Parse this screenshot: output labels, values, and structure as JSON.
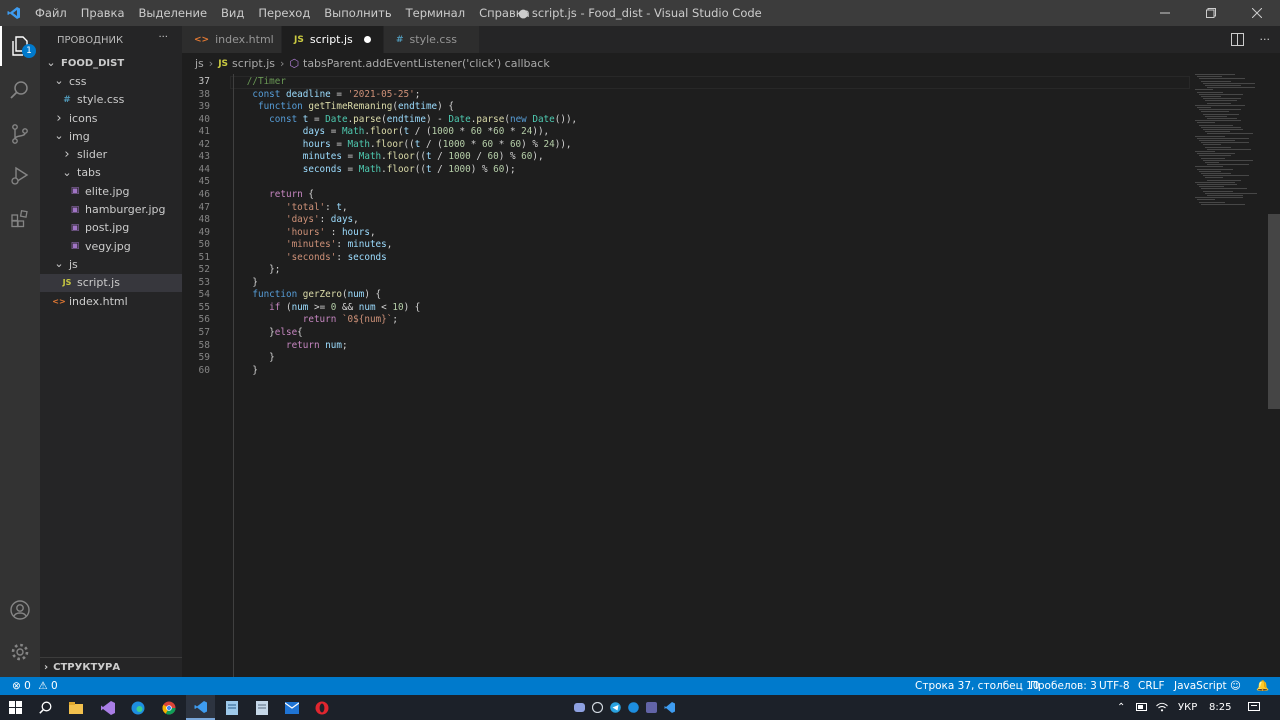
{
  "titlebar": {
    "menu": [
      "Файл",
      "Правка",
      "Выделение",
      "Вид",
      "Переход",
      "Выполнить",
      "Терминал",
      "Справка"
    ],
    "title": "● script.js - Food_dist - Visual Studio Code"
  },
  "activity": {
    "badge": "1"
  },
  "sidebar": {
    "title": "ПРОВОДНИК",
    "more": "···",
    "tree": [
      {
        "label": "FOOD_DIST",
        "type": "root",
        "icon": "chevron-down",
        "level": 0
      },
      {
        "label": "css",
        "type": "folder",
        "icon": "chevron-down",
        "level": 1
      },
      {
        "label": "style.css",
        "type": "css",
        "icon": "#",
        "level": 2
      },
      {
        "label": "icons",
        "type": "folder",
        "icon": "chevron-right",
        "level": 1
      },
      {
        "label": "img",
        "type": "folder",
        "icon": "chevron-down",
        "level": 1
      },
      {
        "label": "slider",
        "type": "folder",
        "icon": "chevron-right",
        "level": 2
      },
      {
        "label": "tabs",
        "type": "folder",
        "icon": "chevron-down",
        "level": 2
      },
      {
        "label": "elite.jpg",
        "type": "img",
        "icon": "image",
        "level": 3
      },
      {
        "label": "hamburger.jpg",
        "type": "img",
        "icon": "image",
        "level": 3
      },
      {
        "label": "post.jpg",
        "type": "img",
        "icon": "image",
        "level": 3
      },
      {
        "label": "vegy.jpg",
        "type": "img",
        "icon": "image",
        "level": 3
      },
      {
        "label": "js",
        "type": "folder",
        "icon": "chevron-down",
        "level": 1
      },
      {
        "label": "script.js",
        "type": "js",
        "icon": "JS",
        "level": 2,
        "selected": true
      },
      {
        "label": "index.html",
        "type": "html",
        "icon": "<>",
        "level": 1
      }
    ],
    "outline": "СТРУКТУРА"
  },
  "tabs": [
    {
      "label": "index.html",
      "icon": "<>",
      "color": "#e37933"
    },
    {
      "label": "script.js",
      "icon": "JS",
      "color": "#cbcb41",
      "active": true,
      "dirty": true
    },
    {
      "label": "style.css",
      "icon": "#",
      "color": "#519aba"
    }
  ],
  "breadcrumb": {
    "folder": "js",
    "file_icon": "JS",
    "file": "script.js",
    "symbol": "tabsParent.addEventListener('click') callback"
  },
  "editor": {
    "current_line": 37,
    "lines": [
      {
        "n": 37,
        "t": [
          [
            "cm",
            "   //Timer"
          ]
        ]
      },
      {
        "n": 38,
        "t": [
          [
            "kw",
            "    const "
          ],
          [
            "var",
            "deadline"
          ],
          [
            "pl",
            " = "
          ],
          [
            "str",
            "'2021-05-25'"
          ],
          [
            "pl",
            ";"
          ]
        ]
      },
      {
        "n": 39,
        "t": [
          [
            "kw",
            "     function "
          ],
          [
            "fn",
            "getTimeRemaning"
          ],
          [
            "pl",
            "("
          ],
          [
            "var",
            "endtime"
          ],
          [
            "pl",
            ") {"
          ]
        ]
      },
      {
        "n": 40,
        "t": [
          [
            "kw",
            "       const "
          ],
          [
            "var",
            "t"
          ],
          [
            "pl",
            " = "
          ],
          [
            "cls",
            "Date"
          ],
          [
            "pl",
            "."
          ],
          [
            "fn",
            "parse"
          ],
          [
            "pl",
            "("
          ],
          [
            "var",
            "endtime"
          ],
          [
            "pl",
            ") - "
          ],
          [
            "cls",
            "Date"
          ],
          [
            "pl",
            "."
          ],
          [
            "fn",
            "parse"
          ],
          [
            "pl",
            "("
          ],
          [
            "kw",
            "new "
          ],
          [
            "cls",
            "Date"
          ],
          [
            "pl",
            "()),"
          ]
        ]
      },
      {
        "n": 41,
        "t": [
          [
            "var",
            "             days"
          ],
          [
            "pl",
            " = "
          ],
          [
            "cls",
            "Math"
          ],
          [
            "pl",
            "."
          ],
          [
            "fn",
            "floor"
          ],
          [
            "pl",
            "("
          ],
          [
            "var",
            "t"
          ],
          [
            "pl",
            " / ("
          ],
          [
            "num",
            "1000"
          ],
          [
            "pl",
            " * "
          ],
          [
            "num",
            "60"
          ],
          [
            "pl",
            " *"
          ],
          [
            "num",
            "60"
          ],
          [
            "pl",
            " * "
          ],
          [
            "num",
            "24"
          ],
          [
            "pl",
            ")),"
          ]
        ]
      },
      {
        "n": 42,
        "t": [
          [
            "var",
            "             hours"
          ],
          [
            "pl",
            " = "
          ],
          [
            "cls",
            "Math"
          ],
          [
            "pl",
            "."
          ],
          [
            "fn",
            "floor"
          ],
          [
            "pl",
            "(("
          ],
          [
            "var",
            "t"
          ],
          [
            "pl",
            " / ("
          ],
          [
            "num",
            "1000"
          ],
          [
            "pl",
            " * "
          ],
          [
            "num",
            "60"
          ],
          [
            "pl",
            " * "
          ],
          [
            "num",
            "60"
          ],
          [
            "pl",
            ") % "
          ],
          [
            "num",
            "24"
          ],
          [
            "pl",
            ")),"
          ]
        ]
      },
      {
        "n": 43,
        "t": [
          [
            "var",
            "             minutes"
          ],
          [
            "pl",
            " = "
          ],
          [
            "cls",
            "Math"
          ],
          [
            "pl",
            "."
          ],
          [
            "fn",
            "floor"
          ],
          [
            "pl",
            "(("
          ],
          [
            "var",
            "t"
          ],
          [
            "pl",
            " / "
          ],
          [
            "num",
            "1000"
          ],
          [
            "pl",
            " / "
          ],
          [
            "num",
            "60"
          ],
          [
            "pl",
            ") % "
          ],
          [
            "num",
            "60"
          ],
          [
            "pl",
            "),"
          ]
        ]
      },
      {
        "n": 44,
        "t": [
          [
            "var",
            "             seconds"
          ],
          [
            "pl",
            " = "
          ],
          [
            "cls",
            "Math"
          ],
          [
            "pl",
            "."
          ],
          [
            "fn",
            "floor"
          ],
          [
            "pl",
            "(("
          ],
          [
            "var",
            "t"
          ],
          [
            "pl",
            " / "
          ],
          [
            "num",
            "1000"
          ],
          [
            "pl",
            ") % "
          ],
          [
            "num",
            "60"
          ],
          [
            "pl",
            ");"
          ]
        ]
      },
      {
        "n": 45,
        "t": [
          [
            "pl",
            ""
          ]
        ]
      },
      {
        "n": 46,
        "t": [
          [
            "ctl",
            "       return"
          ],
          [
            "pl",
            " {"
          ]
        ]
      },
      {
        "n": 47,
        "t": [
          [
            "str",
            "          'total'"
          ],
          [
            "pl",
            ": "
          ],
          [
            "var",
            "t"
          ],
          [
            "pl",
            ","
          ]
        ]
      },
      {
        "n": 48,
        "t": [
          [
            "str",
            "          'days'"
          ],
          [
            "pl",
            ": "
          ],
          [
            "var",
            "days"
          ],
          [
            "pl",
            ","
          ]
        ]
      },
      {
        "n": 49,
        "t": [
          [
            "str",
            "          'hours'"
          ],
          [
            "pl",
            " : "
          ],
          [
            "var",
            "hours"
          ],
          [
            "pl",
            ","
          ]
        ]
      },
      {
        "n": 50,
        "t": [
          [
            "str",
            "          'minutes'"
          ],
          [
            "pl",
            ": "
          ],
          [
            "var",
            "minutes"
          ],
          [
            "pl",
            ","
          ]
        ]
      },
      {
        "n": 51,
        "t": [
          [
            "str",
            "          'seconds'"
          ],
          [
            "pl",
            ": "
          ],
          [
            "var",
            "seconds"
          ]
        ]
      },
      {
        "n": 52,
        "t": [
          [
            "pl",
            "       };"
          ]
        ]
      },
      {
        "n": 53,
        "t": [
          [
            "pl",
            "    }"
          ]
        ]
      },
      {
        "n": 54,
        "t": [
          [
            "kw",
            "    function "
          ],
          [
            "fn",
            "gerZero"
          ],
          [
            "pl",
            "("
          ],
          [
            "var",
            "num"
          ],
          [
            "pl",
            ") {"
          ]
        ]
      },
      {
        "n": 55,
        "t": [
          [
            "ctl",
            "       if"
          ],
          [
            "pl",
            " ("
          ],
          [
            "var",
            "num"
          ],
          [
            "pl",
            " >= "
          ],
          [
            "num",
            "0"
          ],
          [
            "pl",
            " && "
          ],
          [
            "var",
            "num"
          ],
          [
            "pl",
            " < "
          ],
          [
            "num",
            "10"
          ],
          [
            "pl",
            ") {"
          ]
        ]
      },
      {
        "n": 56,
        "t": [
          [
            "ctl",
            "             return"
          ],
          [
            "str",
            " `0${num}`"
          ],
          [
            "pl",
            ";"
          ]
        ]
      },
      {
        "n": 57,
        "t": [
          [
            "pl",
            "       }"
          ],
          [
            "ctl",
            "else"
          ],
          [
            "pl",
            "{"
          ]
        ]
      },
      {
        "n": 58,
        "t": [
          [
            "ctl",
            "          return"
          ],
          [
            "var",
            " num"
          ],
          [
            "pl",
            ";"
          ]
        ]
      },
      {
        "n": 59,
        "t": [
          [
            "pl",
            "       }"
          ]
        ]
      },
      {
        "n": 60,
        "t": [
          [
            "pl",
            "    }"
          ]
        ]
      }
    ]
  },
  "statusbar": {
    "errors": "0",
    "warnings": "0",
    "position": "Строка 37, столбец 10",
    "spaces": "Пробелов: 3",
    "encoding": "UTF-8",
    "eol": "CRLF",
    "language": "JavaScript"
  },
  "taskbar": {
    "lang": "УКР",
    "time": "8:25"
  }
}
